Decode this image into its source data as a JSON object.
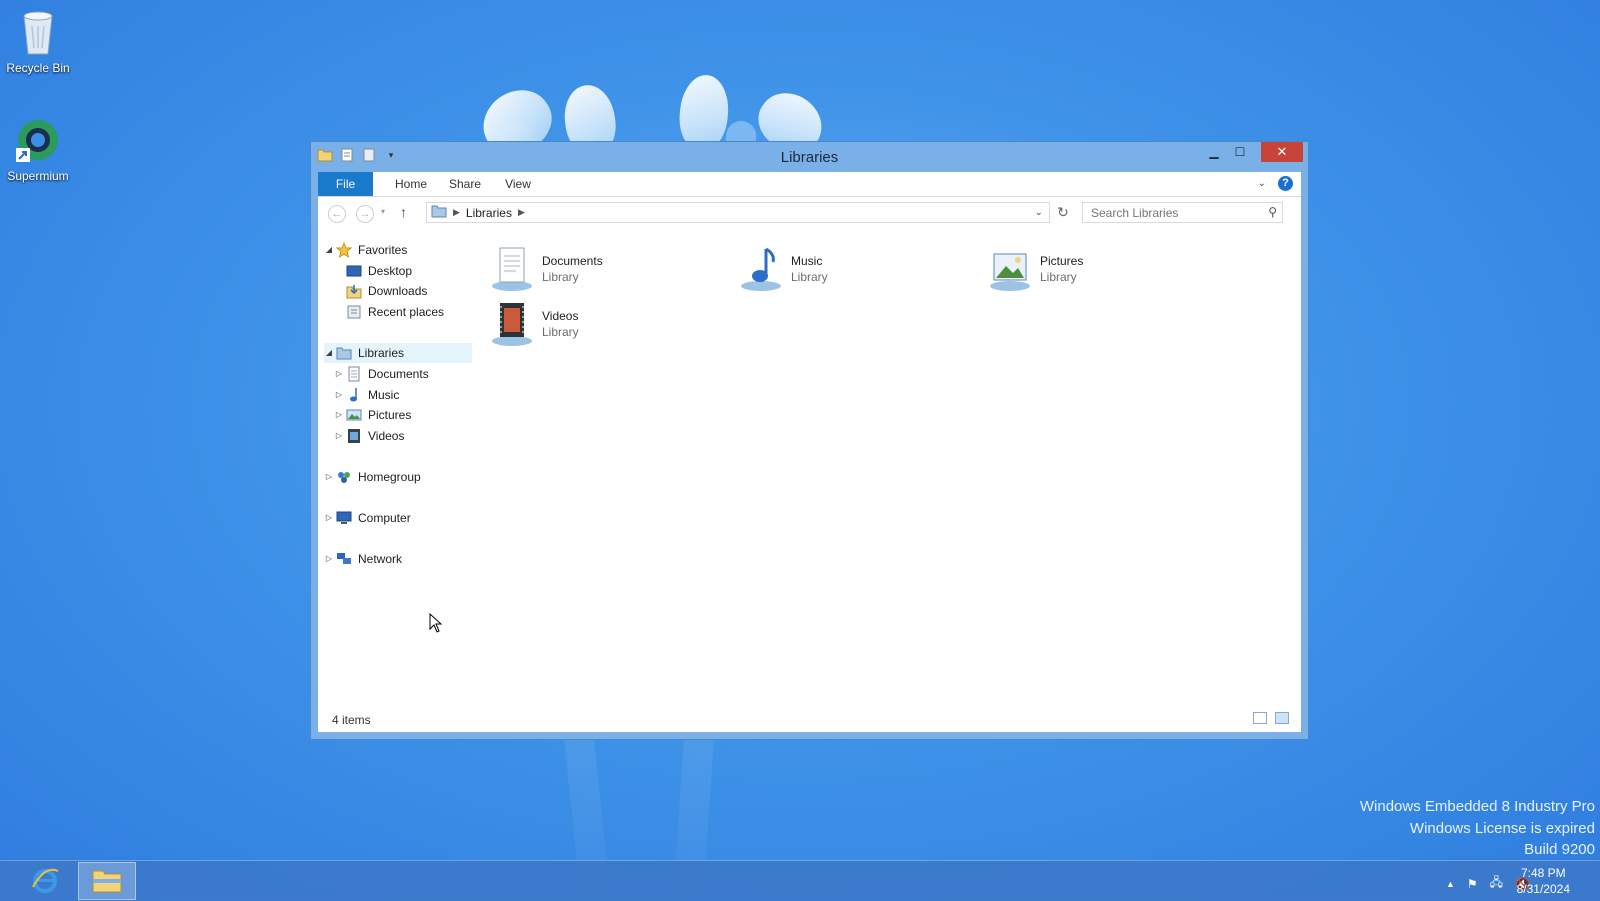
{
  "desktop": {
    "icons": [
      {
        "label": "Recycle Bin",
        "icon": "recycle-bin-icon"
      },
      {
        "label": "Supermium",
        "icon": "supermium-icon"
      }
    ],
    "watermark": {
      "line1": "Windows Embedded 8 Industry Pro",
      "line2": "Windows License is expired",
      "line3": "Build 9200"
    }
  },
  "window": {
    "title": "Libraries",
    "ribbon_tabs": [
      "File",
      "Home",
      "Share",
      "View"
    ],
    "address": {
      "crumb": "Libraries"
    },
    "search_placeholder": "Search Libraries",
    "nav": {
      "favorites": {
        "label": "Favorites",
        "items": [
          "Desktop",
          "Downloads",
          "Recent places"
        ]
      },
      "libraries": {
        "label": "Libraries",
        "items": [
          "Documents",
          "Music",
          "Pictures",
          "Videos"
        ]
      },
      "homegroup": "Homegroup",
      "computer": "Computer",
      "network": "Network"
    },
    "content_items": [
      {
        "name": "Documents",
        "type": "Library",
        "icon": "documents-library-icon"
      },
      {
        "name": "Music",
        "type": "Library",
        "icon": "music-library-icon"
      },
      {
        "name": "Pictures",
        "type": "Library",
        "icon": "pictures-library-icon"
      },
      {
        "name": "Videos",
        "type": "Library",
        "icon": "videos-library-icon"
      }
    ],
    "status": "4 items"
  },
  "taskbar": {
    "apps": [
      {
        "name": "Internet Explorer",
        "icon": "internet-explorer-icon"
      },
      {
        "name": "File Explorer",
        "icon": "file-explorer-icon",
        "active": true
      }
    ],
    "clock": {
      "time": "7:48 PM",
      "date": "8/31/2024"
    }
  },
  "colors": {
    "accent": "#1979ca",
    "close": "#c7443b",
    "frame": "#7ab0e8"
  }
}
